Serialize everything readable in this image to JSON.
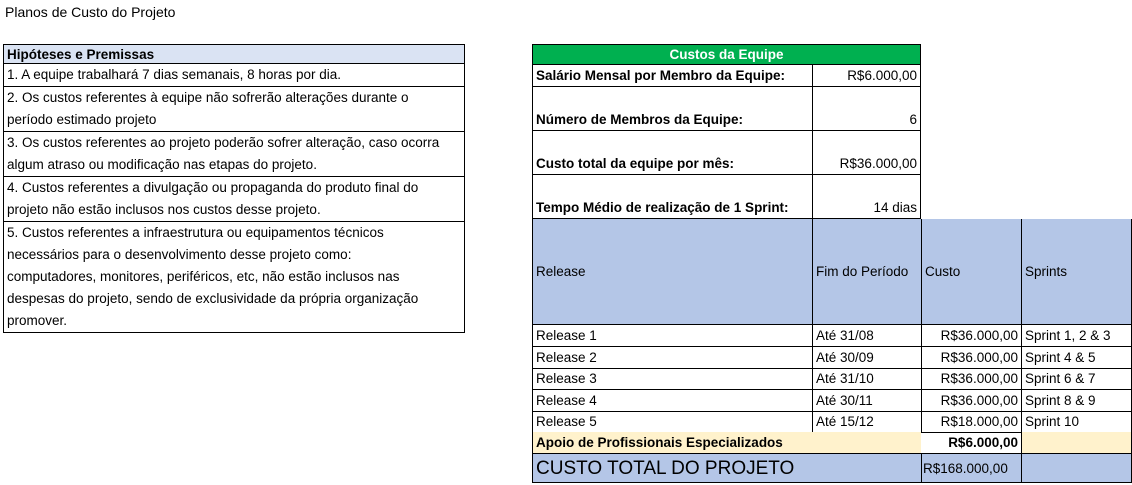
{
  "sheet": {
    "title": "Planos de Custo do Projeto"
  },
  "hypotheses": {
    "header": "Hipóteses e Premissas",
    "items": [
      [
        "1. A equipe trabalhará 7 dias semanais, 8 horas por dia."
      ],
      [
        "2. Os custos referentes à equipe não sofrerão alterações durante o",
        "período estimado projeto"
      ],
      [
        "3. Os custos referentes ao projeto poderão sofrer alteração, caso ocorra",
        "algum atraso ou modificação nas etapas do projeto."
      ],
      [
        "4. Custos referentes a divulgação ou propaganda do produto final do",
        "projeto não estão inclusos nos custos desse projeto."
      ],
      [
        "5. Custos referentes a infraestrutura ou equipamentos técnicos",
        "necessários para o desenvolvimento desse projeto como:",
        "computadores, monitores, periféricos, etc, não estão inclusos nas",
        "despesas do projeto, sendo de exclusividade da própria organização",
        "promover."
      ]
    ]
  },
  "team_costs": {
    "header": "Custos da Equipe",
    "rows": [
      {
        "label": "Salário Mensal por Membro da Equipe:",
        "value": "R$6.000,00"
      },
      {
        "label": "Número de Membros da Equipe:",
        "value": "6"
      },
      {
        "label": "Custo total da equipe por mês:",
        "value": "R$36.000,00"
      },
      {
        "label": "Tempo Médio de realização de 1 Sprint:",
        "value": "14 dias"
      }
    ]
  },
  "releases": {
    "columns": [
      "Release",
      "Fim do Período",
      "Custo",
      "Sprints"
    ],
    "rows": [
      [
        "Release 1",
        "Até 31/08",
        "R$36.000,00",
        "Sprint 1, 2 & 3"
      ],
      [
        "Release 2",
        "Até 30/09",
        "R$36.000,00",
        "Sprint 4 & 5"
      ],
      [
        "Release 3",
        "Até 31/10",
        "R$36.000,00",
        "Sprint 6 & 7"
      ],
      [
        "Release 4",
        "Até 30/11",
        "R$36.000,00",
        "Sprint 8 & 9"
      ],
      [
        "Release 5",
        "Até 15/12",
        "R$18.000,00",
        "Sprint 10"
      ]
    ],
    "support": {
      "label": "Apoio de Profissionais Especializados",
      "value": "R$6.000,00"
    },
    "total": {
      "label": "CUSTO TOTAL DO PROJETO",
      "value": "R$168.000,00"
    }
  }
}
